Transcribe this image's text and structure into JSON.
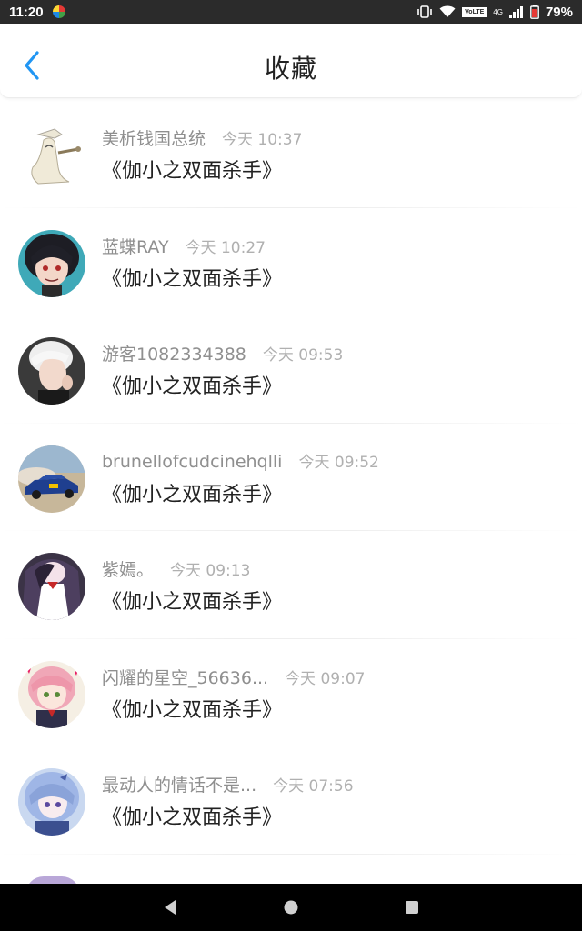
{
  "status_bar": {
    "time": "11:20",
    "volte": "VoLTE",
    "network": "4G",
    "battery": "79%"
  },
  "header": {
    "title": "收藏",
    "back_icon": "chevron-left-icon",
    "accent_color": "#2196f3"
  },
  "items": [
    {
      "username": "美析钱国总统",
      "time": "今天 10:37",
      "title": "《伽小之双面杀手》",
      "avatar": "white-figure-avatar"
    },
    {
      "username": "蓝蝶RAY",
      "time": "今天 10:27",
      "title": "《伽小之双面杀手》",
      "avatar": "anime-boy-avatar"
    },
    {
      "username": "游客1082334388",
      "time": "今天 09:53",
      "title": "《伽小之双面杀手》",
      "avatar": "blond-person-avatar"
    },
    {
      "username": "brunellofcudcinehqlli",
      "time": "今天 09:52",
      "title": "《伽小之双面杀手》",
      "avatar": "rally-car-avatar"
    },
    {
      "username": "紫嫣。",
      "time": "今天 09:13",
      "title": "《伽小之双面杀手》",
      "avatar": "anime-girl-dark-avatar"
    },
    {
      "username": "闪耀的星空_56636...",
      "time": "今天 09:07",
      "title": "《伽小之双面杀手》",
      "avatar": "pink-hair-girl-avatar"
    },
    {
      "username": "最动人的情话不是...",
      "time": "今天 07:56",
      "title": "《伽小之双面杀手》",
      "avatar": "blue-hair-girl-avatar"
    }
  ],
  "nav": {
    "back": "triangle-back-icon",
    "home": "circle-home-icon",
    "recents": "square-recents-icon"
  }
}
